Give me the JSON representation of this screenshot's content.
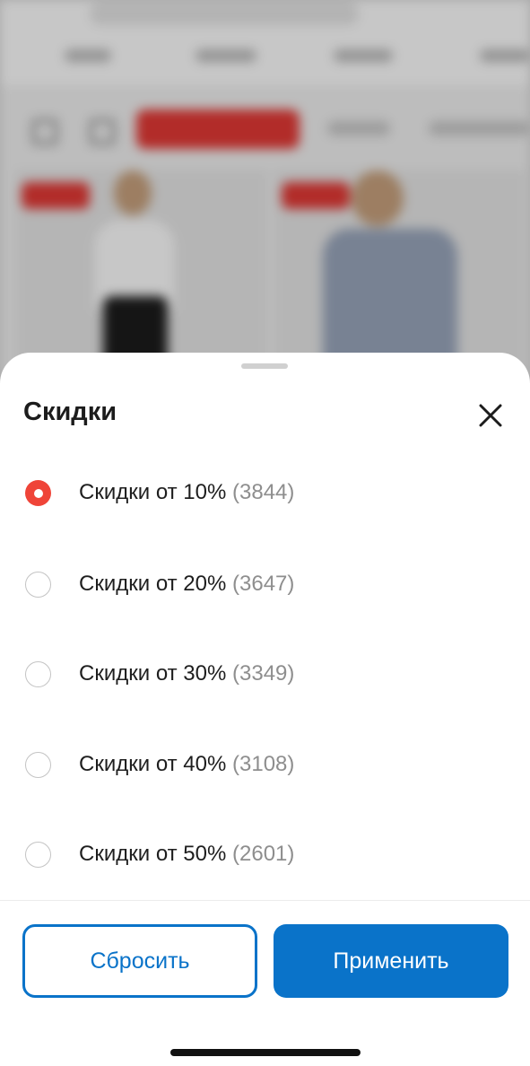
{
  "sheet": {
    "title": "Скидки",
    "options": [
      {
        "label": "Скидки от 10%",
        "count": "(3844)",
        "selected": true
      },
      {
        "label": "Скидки от 20%",
        "count": "(3647)",
        "selected": false
      },
      {
        "label": "Скидки от 30%",
        "count": "(3349)",
        "selected": false
      },
      {
        "label": "Скидки от 40%",
        "count": "(3108)",
        "selected": false
      },
      {
        "label": "Скидки от 50%",
        "count": "(2601)",
        "selected": false
      }
    ],
    "reset_label": "Сбросить",
    "apply_label": "Применить"
  },
  "colors": {
    "accent_red": "#ef4438",
    "brand_blue": "#0a73c9"
  }
}
